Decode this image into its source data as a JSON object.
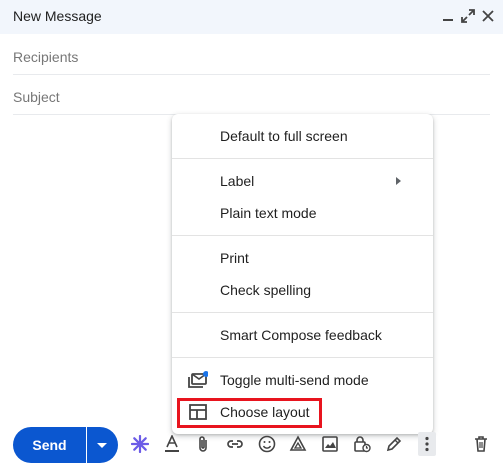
{
  "header": {
    "title": "New Message",
    "icons": [
      "minimize-icon",
      "expand-icon",
      "close-icon"
    ]
  },
  "fields": {
    "recipients_placeholder": "Recipients",
    "subject_placeholder": "Subject"
  },
  "menu": {
    "items": [
      {
        "label": "Default to full screen"
      },
      {
        "label": "Label",
        "has_submenu": true
      },
      {
        "label": "Plain text mode"
      },
      {
        "label": "Print"
      },
      {
        "label": "Check spelling"
      },
      {
        "label": "Smart Compose feedback"
      },
      {
        "label": "Toggle multi-send mode",
        "icon": "multi-send-icon",
        "badge_color": "#1a73e8"
      },
      {
        "label": "Choose layout",
        "icon": "layout-icon",
        "highlighted": true
      }
    ]
  },
  "toolbar": {
    "send_label": "Send",
    "accent": "#0b57d0",
    "icons": [
      "gemini-icon",
      "formatting-icon",
      "attach-icon",
      "link-icon",
      "emoji-icon",
      "drive-icon",
      "photo-icon",
      "lock-clock-icon",
      "signature-icon",
      "more-options-icon",
      "trash-icon"
    ]
  },
  "colors": {
    "header_bg": "#f2f6fc",
    "highlight_border": "#e8141e",
    "badge_blue": "#1a73e8"
  }
}
